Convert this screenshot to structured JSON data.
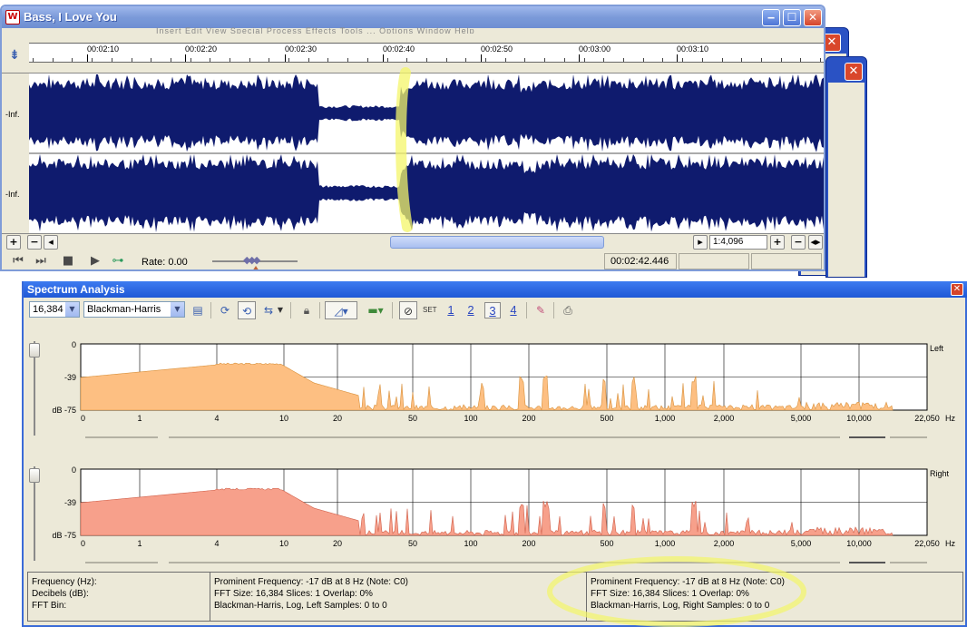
{
  "main_window": {
    "title": "Bass, I Love You",
    "menu_ghost": "Insert   Edit   View   Special   Process   Effects   Tools   ...   Options   Window   Help",
    "timeline_labels": [
      "00:02:10",
      "00:02:20",
      "00:02:30",
      "00:02:40",
      "00:02:50",
      "00:03:00",
      "00:03:10"
    ],
    "channel_labels": [
      "-Inf.",
      "-Inf."
    ],
    "zoom_value": "1:4,096",
    "rate_label": "Rate: 0.00",
    "cursor_time": "00:02:42.446"
  },
  "spectrum": {
    "title": "Spectrum Analysis",
    "fft_size_select": "16,384",
    "window_select": "Blackman-Harris",
    "set_label": "SET",
    "snapshot_buttons": [
      "1",
      "2",
      "3",
      "4"
    ],
    "db_labels": [
      "0",
      "-39",
      "dB -75"
    ],
    "freq_labels": [
      "0",
      "1",
      "4",
      "10",
      "20",
      "50",
      "100",
      "200",
      "500",
      "1,000",
      "2,000",
      "5,000",
      "10,000",
      "22,050"
    ],
    "hz_label": "Hz",
    "channels": [
      {
        "name": "Left",
        "color": "#fdbf82"
      },
      {
        "name": "Right",
        "color": "#f7a08b"
      }
    ],
    "info": {
      "labels": [
        "Frequency (Hz):",
        "Decibels (dB):",
        "FFT Bin:"
      ],
      "left": [
        "Prominent Frequency: -17 dB at 8 Hz (Note: C0)",
        "FFT Size: 16,384  Slices: 1  Overlap: 0%",
        "Blackman-Harris, Log, Left   Samples: 0 to 0"
      ],
      "right": [
        "Prominent Frequency: -17 dB at 8 Hz (Note: C0)",
        "FFT Size: 16,384  Slices: 1  Overlap: 0%",
        "Blackman-Harris, Log, Right   Samples: 0 to 0"
      ]
    }
  },
  "colors": {
    "waveform": "#0f1b6e",
    "highlighter": "#f4f56a",
    "title_blue": "#7b9ad9"
  }
}
